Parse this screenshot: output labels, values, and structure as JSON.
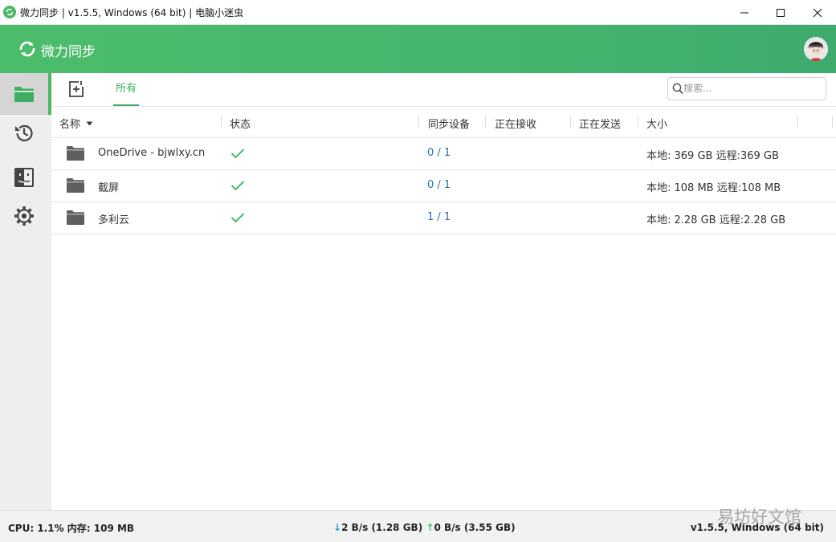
{
  "window": {
    "title": "微力同步 | v1.5.5, Windows (64 bit) | 电脑小迷虫"
  },
  "header": {
    "brand": "微力同步"
  },
  "toolbar": {
    "tab_all": "所有",
    "search_placeholder": "搜索..."
  },
  "table": {
    "columns": {
      "name": "名称",
      "status": "状态",
      "devices": "同步设备",
      "receiving": "正在接收",
      "sending": "正在发送",
      "size": "大小"
    },
    "rows": [
      {
        "name": "OneDrive - bjwlxy.cn",
        "status": "synced",
        "devices": "0 / 1",
        "size": "本地: 369 GB 远程:369 GB"
      },
      {
        "name": "截屏",
        "status": "synced",
        "devices": "0 / 1",
        "size": "本地: 108 MB 远程:108 MB"
      },
      {
        "name": "多利云",
        "status": "synced",
        "devices": "1 / 1",
        "size": "本地: 2.28 GB 远程:2.28 GB"
      }
    ]
  },
  "statusbar": {
    "cpu_mem": "CPU: 1.1% 内存: 109 MB",
    "down": "2 B/s (1.28 GB)",
    "up": "0 B/s (3.55 GB)",
    "version": "v1.5.5, Windows (64 bit)"
  },
  "watermark": "易坊好文馆",
  "colors": {
    "accent": "#4cb866",
    "link": "#2f6fa8",
    "folder": "#5f5f5f"
  },
  "icons": {
    "sidebar": [
      "folder-icon",
      "history-icon",
      "finder-icon",
      "gear-icon"
    ]
  }
}
